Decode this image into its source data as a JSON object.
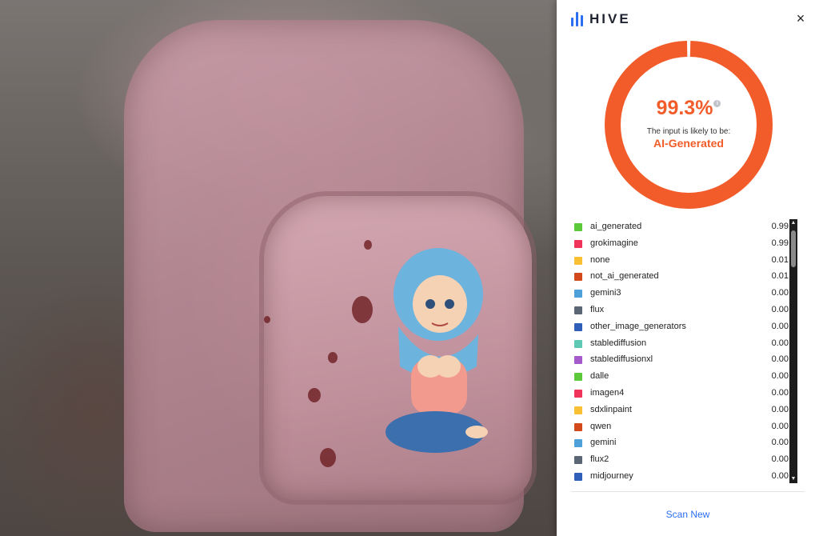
{
  "app": {
    "brand": "HIVE",
    "close_symbol": "×"
  },
  "result": {
    "score": "99.3%",
    "score_fraction": 0.993,
    "info_symbol": "i",
    "subtitle": "The input is likely to be:",
    "verdict": "AI-Generated",
    "accent_color": "#f25c2a",
    "track_color": "#ffffff"
  },
  "classes": [
    {
      "label": "ai_generated",
      "value": "0.99",
      "color": "#5cc93a"
    },
    {
      "label": "grokimagine",
      "value": "0.99",
      "color": "#f0335b"
    },
    {
      "label": "none",
      "value": "0.01",
      "color": "#f9c033"
    },
    {
      "label": "not_ai_generated",
      "value": "0.01",
      "color": "#d24a1c"
    },
    {
      "label": "gemini3",
      "value": "0.00",
      "color": "#4ea1d8"
    },
    {
      "label": "flux",
      "value": "0.00",
      "color": "#5a6673"
    },
    {
      "label": "other_image_generators",
      "value": "0.00",
      "color": "#2f5fb8"
    },
    {
      "label": "stablediffusion",
      "value": "0.00",
      "color": "#5ec8b4"
    },
    {
      "label": "stablediffusionxl",
      "value": "0.00",
      "color": "#a55ac9"
    },
    {
      "label": "dalle",
      "value": "0.00",
      "color": "#5cc93a"
    },
    {
      "label": "imagen4",
      "value": "0.00",
      "color": "#f0335b"
    },
    {
      "label": "sdxlinpaint",
      "value": "0.00",
      "color": "#f9c033"
    },
    {
      "label": "qwen",
      "value": "0.00",
      "color": "#d24a1c"
    },
    {
      "label": "gemini",
      "value": "0.00",
      "color": "#4ea1d8"
    },
    {
      "label": "flux2",
      "value": "0.00",
      "color": "#5a6673"
    },
    {
      "label": "midjourney",
      "value": "0.00",
      "color": "#2f5fb8"
    }
  ],
  "scroll": {
    "up_symbol": "▲",
    "down_symbol": "▼"
  },
  "footer": {
    "scan_new_label": "Scan New"
  },
  "icons": {
    "logo": "hive-logo-icon",
    "close": "close-icon",
    "info": "info-icon"
  }
}
